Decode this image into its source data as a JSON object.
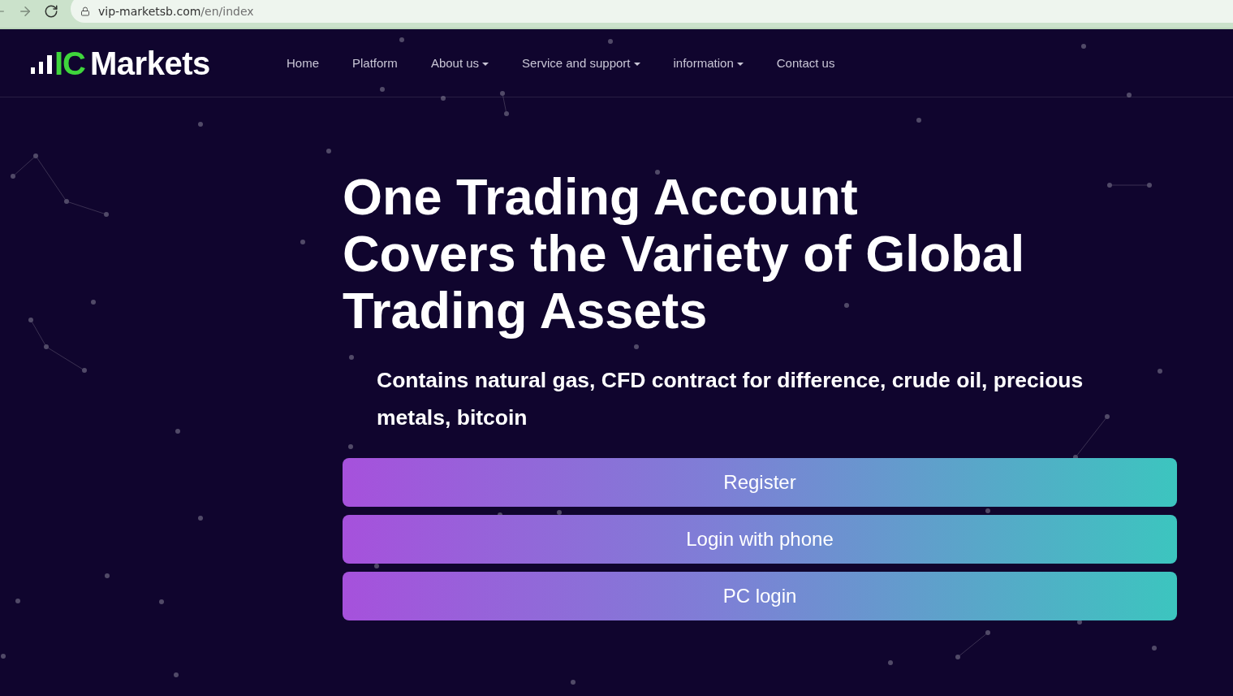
{
  "browser": {
    "host": "vip-marketsb.com",
    "path": "/en/index"
  },
  "logo": {
    "initials": "IC",
    "name": "Markets"
  },
  "nav": [
    {
      "label": "Home",
      "dropdown": false
    },
    {
      "label": "Platform",
      "dropdown": false
    },
    {
      "label": "About us",
      "dropdown": true
    },
    {
      "label": "Service and support",
      "dropdown": true
    },
    {
      "label": "information",
      "dropdown": true
    },
    {
      "label": "Contact us",
      "dropdown": false
    }
  ],
  "hero": {
    "heading_lines": [
      "One Trading Account",
      "Covers the Variety of Global",
      "Trading Assets"
    ],
    "subtitle": "Contains natural gas, CFD contract for difference, crude oil, precious metals, bitcoin",
    "buttons": [
      "Register",
      "Login with phone",
      "PC login"
    ]
  }
}
